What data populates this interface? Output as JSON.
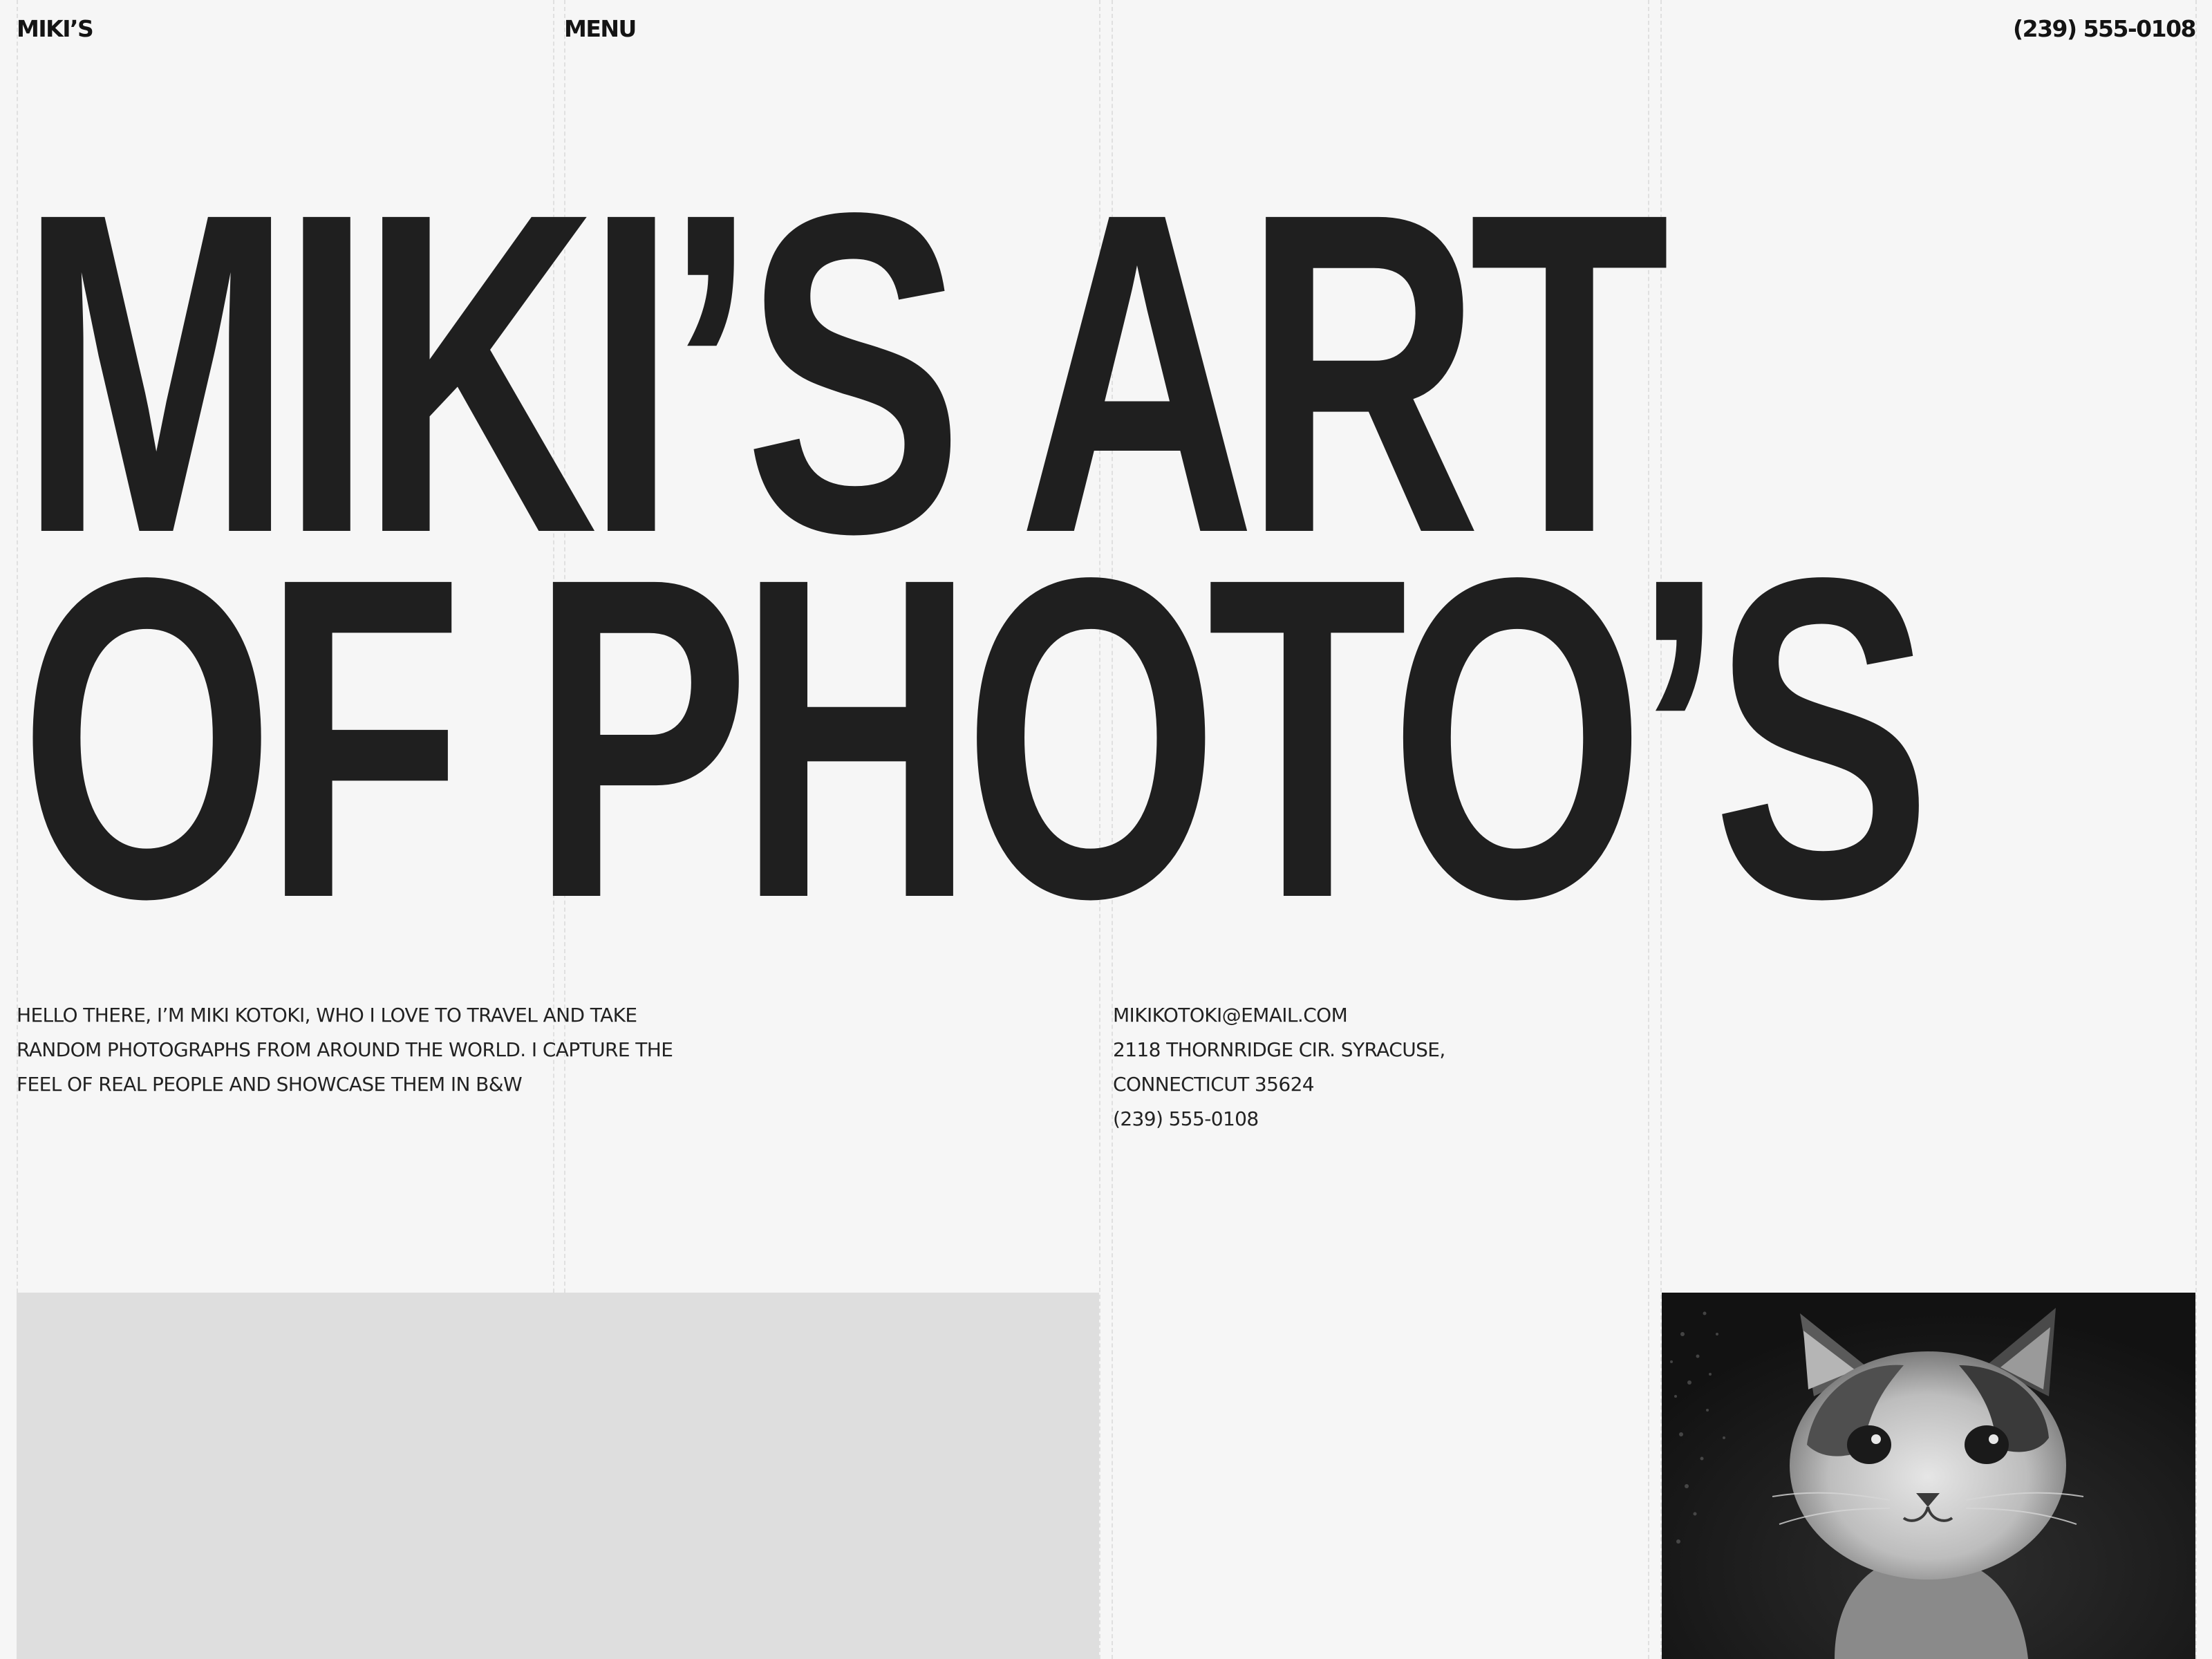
{
  "header": {
    "brand": "MIKI’S",
    "menu_label": "MENU",
    "phone": "(239) 555-0108"
  },
  "hero": {
    "line1": "MIKI’S ART",
    "line2": "OF PHOTO’S"
  },
  "intro": {
    "text": "HELLO THERE, I’M MIKI KOTOKI, WHO I LOVE TO TRAVEL AND TAKE RANDOM PHOTOGRAPHS FROM AROUND THE WORLD. I CAPTURE THE FEEL OF REAL PEOPLE AND SHOWCASE THEM IN B&W"
  },
  "contact": {
    "email": "MIKIKOTOKI@EMAIL.COM",
    "address_line1": "2118 THORNRIDGE CIR. SYRACUSE,",
    "address_line2": "CONNECTICUT 35624",
    "phone": "(239) 555-0108"
  },
  "gallery": {
    "photo_1_icon": "image-placeholder",
    "photo_2_icon": "kitten-photo"
  },
  "colors": {
    "background": "#f6f6f6",
    "text": "#1f1f1f",
    "placeholder": "#dedede"
  }
}
